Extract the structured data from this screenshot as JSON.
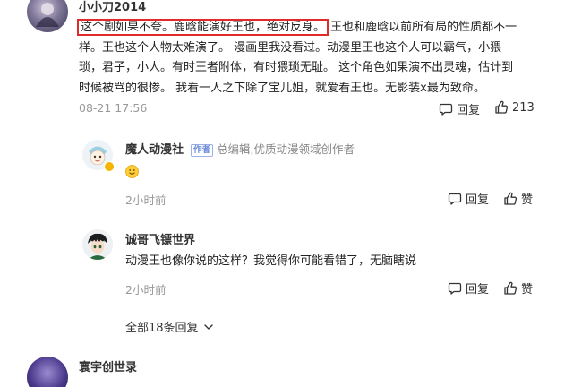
{
  "main_comment": {
    "username": "小小刀2014",
    "text_highlight": "这个剧如果不夸。鹿晗能演好王也，绝对反身。",
    "text_line1_rest": "王也和鹿晗以前所有局的性质都不一",
    "text_line2": "样。王也这个人物太难演了。 漫画里我没看过。动漫里王也这个人可以霸气，小猥",
    "text_line3": "琐，君子，小人。有时王者附体，有时猥琐无耻。 这个角色如果演不出灵魂，估计到",
    "text_line4": "时候被骂的很惨。 我看一人之下除了宝儿姐，就爱看王也。无影装x最为致命。",
    "timestamp": "08-21 17:56",
    "reply_label": "回复",
    "like_count": "213"
  },
  "replies": [
    {
      "username": "魔人动漫社",
      "badge": "作者",
      "desc": "总编辑,优质动漫领域创作者",
      "text": "",
      "emoji": "smile",
      "timestamp": "2小时前",
      "reply_label": "回复",
      "like_label": "赞"
    },
    {
      "username": "诚哥飞镖世界",
      "badge": "",
      "desc": "",
      "text": "动漫王也像你说的这样？我觉得你可能看错了，无脑瞎说",
      "emoji": "",
      "timestamp": "2小时前",
      "reply_label": "回复",
      "like_label": "赞"
    }
  ],
  "expand": {
    "label": "全部18条回复"
  },
  "next_comment": {
    "username": "寰宇创世录"
  },
  "colors": {
    "highlight_box": "#e02b2b",
    "verified": "#f5b400",
    "muted": "#999999"
  }
}
